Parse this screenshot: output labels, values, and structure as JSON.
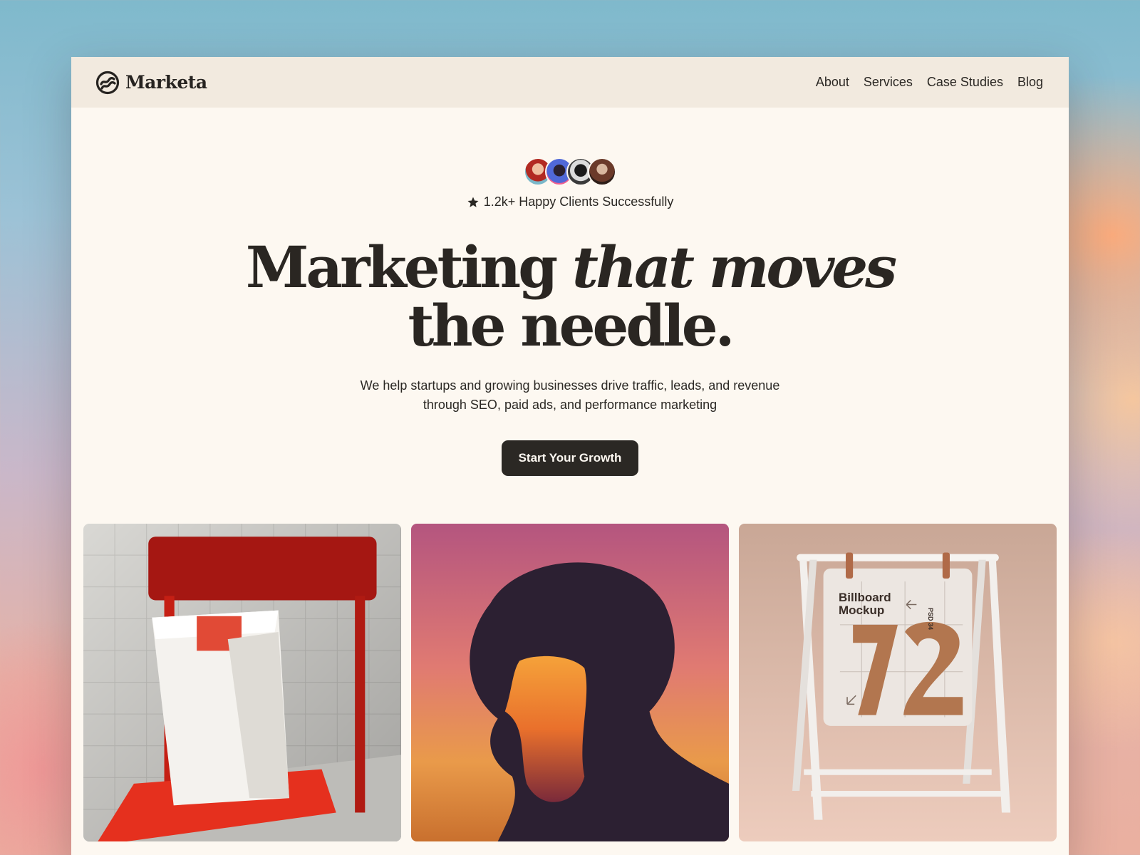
{
  "brand": {
    "name": "Marketa"
  },
  "nav": {
    "items": [
      {
        "label": "About"
      },
      {
        "label": "Services"
      },
      {
        "label": "Case Studies"
      },
      {
        "label": "Blog"
      }
    ]
  },
  "hero": {
    "clients_text": "1.2k+ Happy Clients Successfully",
    "headline_part1": "Marketing ",
    "headline_italic": "that moves",
    "headline_line2": "the needle.",
    "subtext": "We help startups and growing businesses drive traffic, leads, and revenue through SEO, paid ads, and performance marketing",
    "cta_label": "Start Your Growth"
  },
  "gallery": {
    "billboard_title": "Billboard Mockup",
    "billboard_tag": "PSD 34",
    "billboard_number": "72"
  },
  "icons": {
    "logo": "marketa-logo-icon",
    "star": "star-icon"
  },
  "colors": {
    "page_bg": "#fdf8f1",
    "nav_bg": "#f2eadf",
    "text_dark": "#2a2622",
    "cta_bg": "#2b2824"
  }
}
